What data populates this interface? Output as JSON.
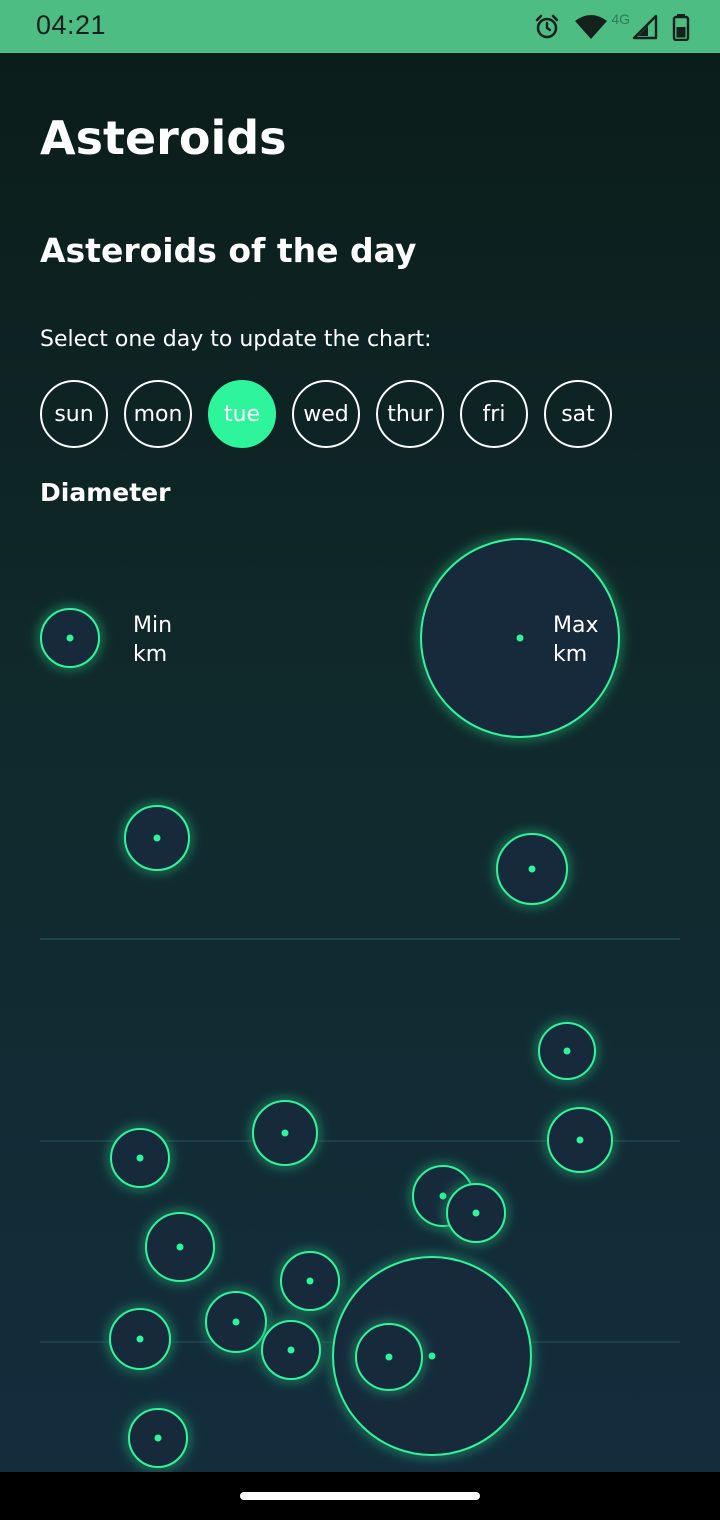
{
  "status_bar": {
    "time": "04:21",
    "network_label": "4G",
    "icons": [
      "alarm-icon",
      "wifi-icon",
      "cell-signal-icon",
      "battery-icon"
    ]
  },
  "page": {
    "title": "Asteroids",
    "section_title": "Asteroids of the day",
    "select_hint": "Select one day to update the chart:"
  },
  "days": [
    {
      "label": "sun",
      "selected": false
    },
    {
      "label": "mon",
      "selected": false
    },
    {
      "label": "tue",
      "selected": true
    },
    {
      "label": "wed",
      "selected": false
    },
    {
      "label": "thur",
      "selected": false
    },
    {
      "label": "fri",
      "selected": false
    },
    {
      "label": "sat",
      "selected": false
    }
  ],
  "chart": {
    "label": "Diameter",
    "legend": {
      "min_label": "Min",
      "min_unit": "km",
      "max_label": "Max",
      "max_unit": "km"
    }
  },
  "colors": {
    "accent": "#2ef59b",
    "bubble_fill": "#162a3a",
    "status_bar": "#4dbd84",
    "background_top": "#0b1d1a",
    "background_bottom": "#132d3d"
  }
}
